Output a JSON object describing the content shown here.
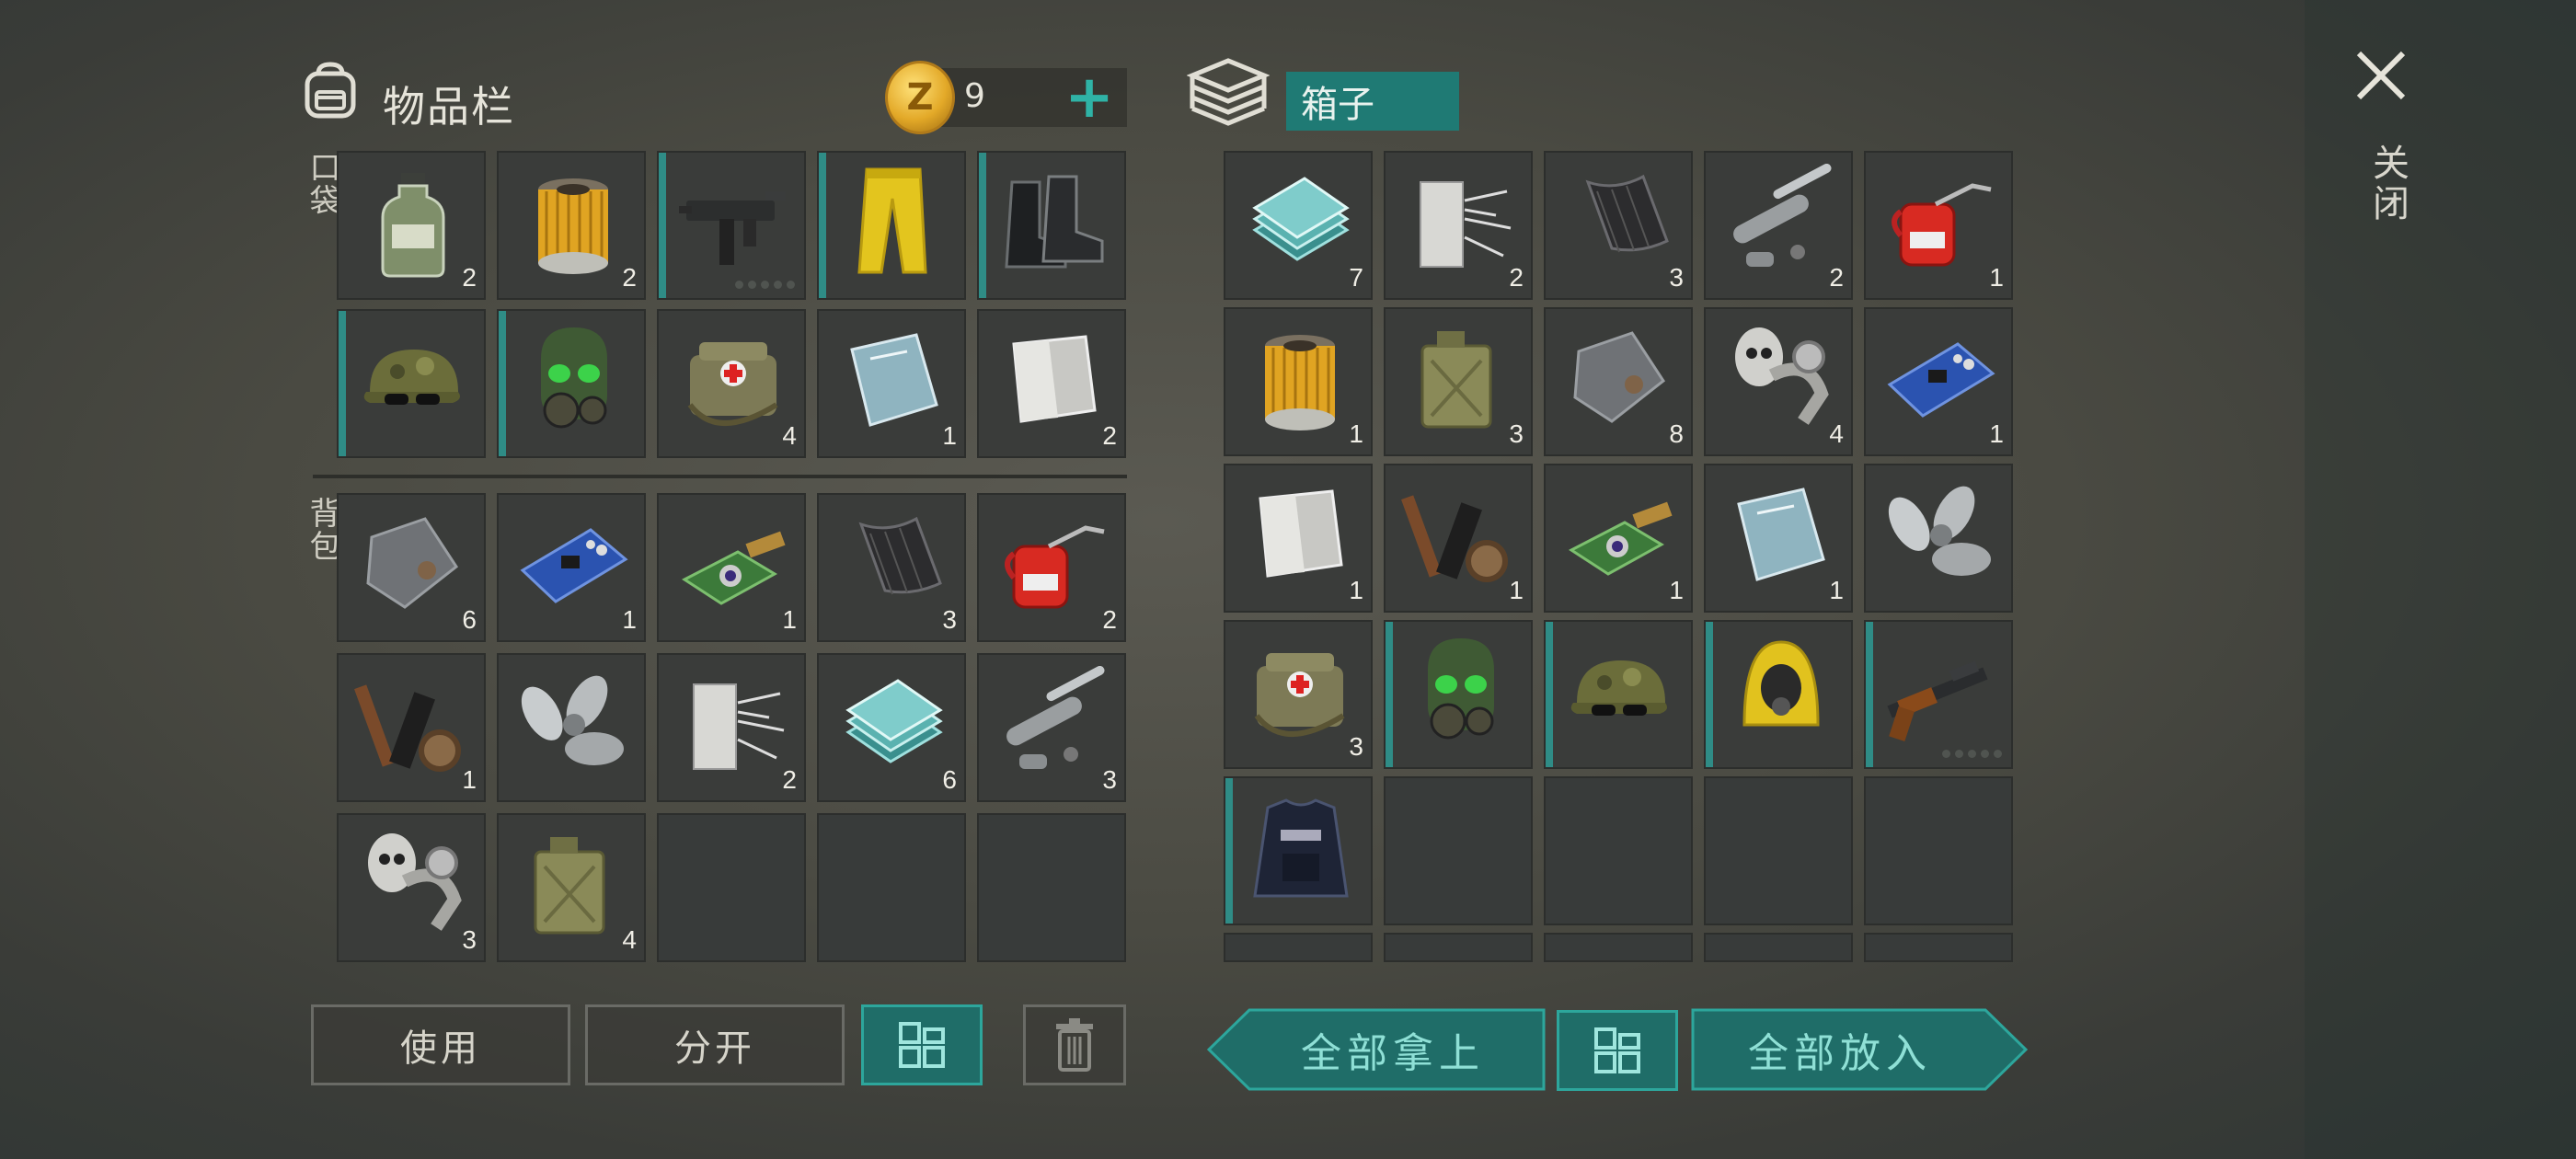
{
  "header": {
    "inventory_title": "物品栏",
    "coins": "9",
    "box_title": "箱子",
    "close_label": "关闭"
  },
  "sections": {
    "pocket": "口袋",
    "backpack": "背包"
  },
  "inventory": {
    "pocket": [
      {
        "icon": "bottle-icon",
        "qty": "2",
        "bar": false
      },
      {
        "icon": "fuel-filter-icon",
        "qty": "2",
        "bar": false
      },
      {
        "icon": "uzi-icon",
        "qty": "",
        "bar": true,
        "durability": true
      },
      {
        "icon": "yellow-pants-icon",
        "qty": "",
        "bar": true
      },
      {
        "icon": "boots-icon",
        "qty": "",
        "bar": true
      },
      {
        "icon": "camo-cap-icon",
        "qty": "",
        "bar": true
      },
      {
        "icon": "gas-mask-icon",
        "qty": "",
        "bar": true
      },
      {
        "icon": "medkit-bag-icon",
        "qty": "4",
        "bar": false
      },
      {
        "icon": "glass-pane-icon",
        "qty": "1",
        "bar": false
      },
      {
        "icon": "steel-plate-icon",
        "qty": "2",
        "bar": false
      }
    ],
    "backpack": [
      {
        "icon": "iron-plate-icon",
        "qty": "6"
      },
      {
        "icon": "circuit-board-icon",
        "qty": "1"
      },
      {
        "icon": "camera-module-icon",
        "qty": "1"
      },
      {
        "icon": "mesh-icon",
        "qty": "3"
      },
      {
        "icon": "oil-can-icon",
        "qty": "2"
      },
      {
        "icon": "tools-set-icon",
        "qty": "1"
      },
      {
        "icon": "propeller-icon",
        "qty": ""
      },
      {
        "icon": "fiberglass-icon",
        "qty": "2"
      },
      {
        "icon": "glass-stack-icon",
        "qty": "6"
      },
      {
        "icon": "pipe-parts-icon",
        "qty": "3"
      },
      {
        "icon": "pump-parts-icon",
        "qty": "3"
      },
      {
        "icon": "jerrycan-icon",
        "qty": "4"
      },
      {
        "icon": "empty",
        "qty": ""
      },
      {
        "icon": "empty",
        "qty": ""
      },
      {
        "icon": "empty",
        "qty": ""
      }
    ]
  },
  "box": [
    {
      "icon": "glass-stack-icon",
      "qty": "7",
      "bar": false
    },
    {
      "icon": "fiberglass-icon",
      "qty": "2",
      "bar": false
    },
    {
      "icon": "mesh-icon",
      "qty": "3",
      "bar": false
    },
    {
      "icon": "pipe-parts-icon",
      "qty": "2",
      "bar": false
    },
    {
      "icon": "oil-can-icon",
      "qty": "1",
      "bar": false
    },
    {
      "icon": "fuel-filter-icon",
      "qty": "1",
      "bar": false
    },
    {
      "icon": "jerrycan-icon",
      "qty": "3",
      "bar": false
    },
    {
      "icon": "iron-plate-icon",
      "qty": "8",
      "bar": false
    },
    {
      "icon": "pump-parts-icon",
      "qty": "4",
      "bar": false
    },
    {
      "icon": "circuit-board-icon",
      "qty": "1",
      "bar": false
    },
    {
      "icon": "steel-plate-icon",
      "qty": "1",
      "bar": false
    },
    {
      "icon": "tools-set-icon",
      "qty": "1",
      "bar": false
    },
    {
      "icon": "camera-module-icon",
      "qty": "1",
      "bar": false
    },
    {
      "icon": "glass-pane-icon",
      "qty": "1",
      "bar": false
    },
    {
      "icon": "propeller-icon",
      "qty": "",
      "bar": false
    },
    {
      "icon": "medkit-bag-icon",
      "qty": "3",
      "bar": false
    },
    {
      "icon": "gas-mask-icon",
      "qty": "",
      "bar": true
    },
    {
      "icon": "camo-cap-icon",
      "qty": "",
      "bar": true
    },
    {
      "icon": "hazmat-hood-icon",
      "qty": "",
      "bar": true
    },
    {
      "icon": "shotgun-icon",
      "qty": "",
      "bar": true,
      "durability": true
    },
    {
      "icon": "police-vest-icon",
      "qty": "",
      "bar": true
    },
    {
      "icon": "empty",
      "qty": "",
      "bar": false
    },
    {
      "icon": "empty",
      "qty": "",
      "bar": false
    },
    {
      "icon": "empty",
      "qty": "",
      "bar": false
    },
    {
      "icon": "empty",
      "qty": "",
      "bar": false
    }
  ],
  "buttons": {
    "use": "使用",
    "split": "分开",
    "take_all": "全部拿上",
    "put_all": "全部放入"
  }
}
